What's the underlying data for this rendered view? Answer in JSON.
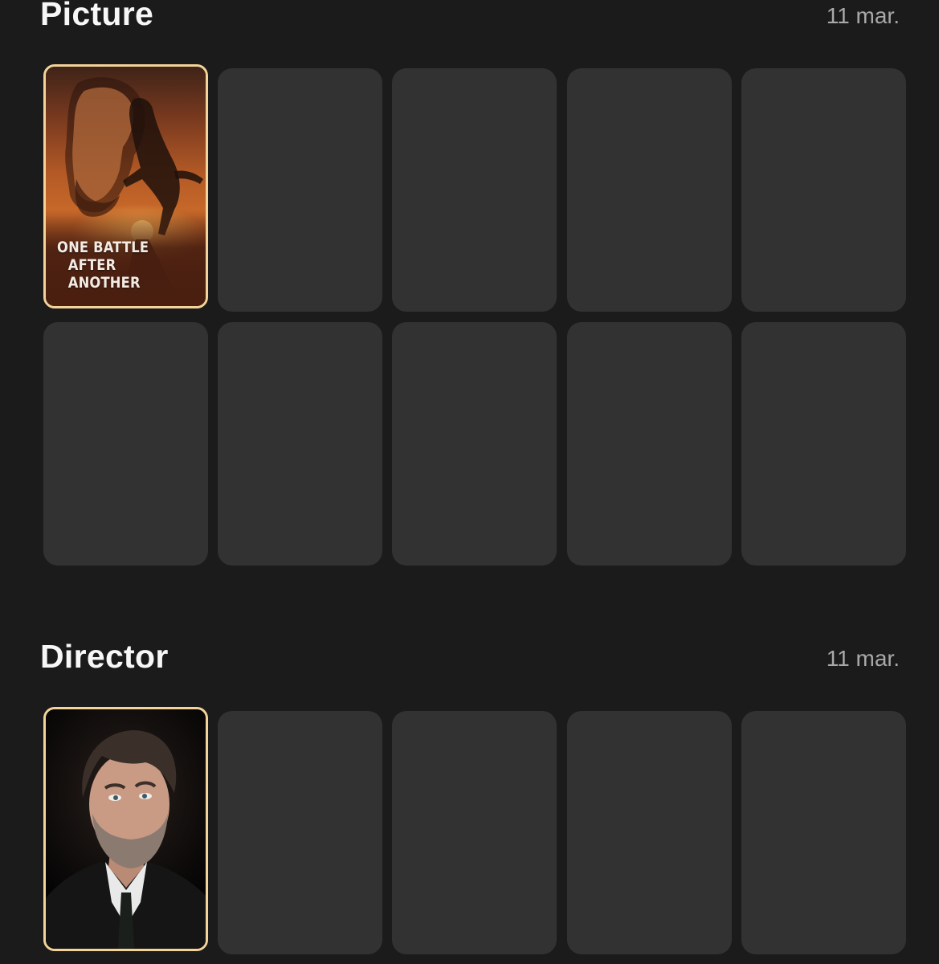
{
  "sections": [
    {
      "title": "Picture",
      "date": "11 mar.",
      "filled": {
        "image": "movie-poster",
        "poster_title_lines": [
          "ONE BATTLE",
          "AFTER ANOTHER"
        ]
      },
      "slot_count": 10
    },
    {
      "title": "Director",
      "date": "11 mar.",
      "filled": {
        "image": "director-portrait"
      },
      "slot_count": 5
    }
  ],
  "colors": {
    "background": "#1b1b1b",
    "slot": "#323232",
    "selected_border": "#f3d39a",
    "date_text": "#a9a9a9"
  }
}
